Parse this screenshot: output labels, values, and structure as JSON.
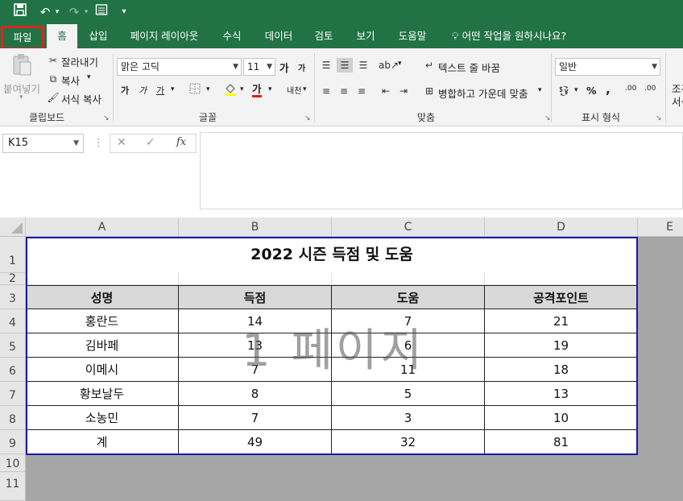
{
  "quick_access": {
    "save_icon": "save-icon",
    "undo_icon": "undo-icon",
    "redo_icon": "redo-icon",
    "form_icon": "form-icon",
    "customize_icon": "customize-icon"
  },
  "tabs": [
    {
      "label": "파일"
    },
    {
      "label": "홈"
    },
    {
      "label": "삽입"
    },
    {
      "label": "페이지 레이아웃"
    },
    {
      "label": "수식"
    },
    {
      "label": "데이터"
    },
    {
      "label": "검토"
    },
    {
      "label": "보기"
    },
    {
      "label": "도움말"
    },
    {
      "label": "어떤 작업을 원하시나요?"
    }
  ],
  "ribbon": {
    "clipboard": {
      "paste": "붙여넣기",
      "cut": "잘라내기",
      "copy": "복사",
      "format_painter": "서식 복사",
      "label": "클립보드"
    },
    "font": {
      "name": "맑은 고딕",
      "size": "11",
      "grow": "가",
      "shrink": "가",
      "bold": "가",
      "italic": "가",
      "underline": "가",
      "font_color": "가",
      "phonetic": "내천",
      "label": "글꼴"
    },
    "alignment": {
      "wrap_text": "텍스트 줄 바꿈",
      "merge_center": "병합하고 가운데 맞춤",
      "label": "맞춤"
    },
    "number": {
      "format": "일반",
      "percent": "%",
      "comma": ",",
      "inc_decimal": ".00",
      "dec_decimal": ".00",
      "label": "표시 형식"
    },
    "styles": {
      "conditional": "조건",
      "table": "서식"
    }
  },
  "formula_bar": {
    "name_box": "K15",
    "cancel": "✕",
    "enter": "✓",
    "fx": "fx",
    "formula": ""
  },
  "columns": [
    "A",
    "B",
    "C",
    "D",
    "E"
  ],
  "rows": [
    "1",
    "2",
    "3",
    "4",
    "5",
    "6",
    "7",
    "8",
    "9",
    "10",
    "11"
  ],
  "sheet": {
    "title": "2022 시즌 득점 및 도움",
    "headers": [
      "성명",
      "득점",
      "도움",
      "공격포인트"
    ],
    "data": [
      [
        "홍란드",
        "14",
        "7",
        "21"
      ],
      [
        "김바페",
        "13",
        "6",
        "19"
      ],
      [
        "이메시",
        "7",
        "11",
        "18"
      ],
      [
        "황보날두",
        "8",
        "5",
        "13"
      ],
      [
        "소농민",
        "7",
        "3",
        "10"
      ],
      [
        "계",
        "49",
        "32",
        "81"
      ]
    ]
  },
  "watermark": "1 페이지",
  "colors": {
    "excel_green": "#217346",
    "file_highlight": "#e0231f",
    "print_border": "#1a1aa8",
    "header_fill": "#d9d9d9"
  }
}
